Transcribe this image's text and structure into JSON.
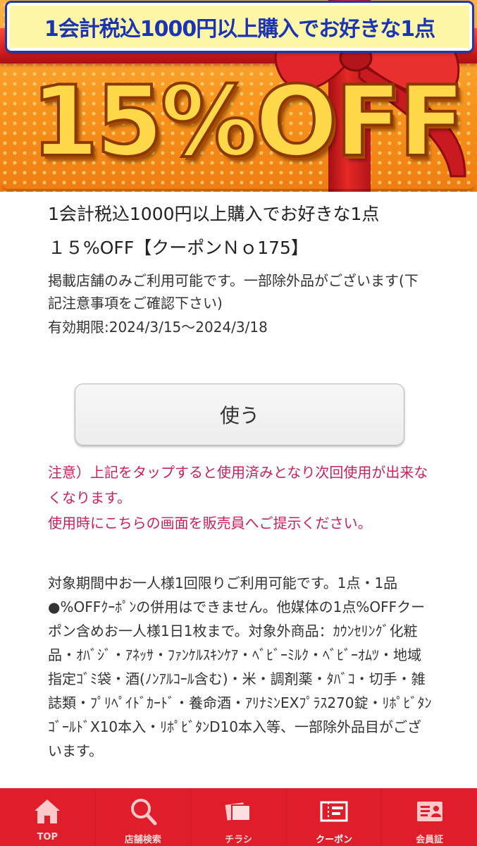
{
  "banner": {
    "headline": "1会計税込1000円以上購入でお好きな1点",
    "discount": "15%OFF",
    "colors": {
      "background": "#f7941d",
      "ribbon": "#d61f1f",
      "headline_text": "#1a34b5",
      "discount_text": "#ffd84a"
    }
  },
  "coupon": {
    "title_line1": "1会計税込1000円以上購入でお好きな1点",
    "title_line2": "１５%OFF【クーポンＮｏ175】",
    "description": "掲載店舗のみご利用可能です。一部除外品がございます(下記注意事項をご確認下さい)",
    "validity": "有効期限:2024/3/15～2024/3/18",
    "use_button": "使う",
    "warning_line1": "注意）上記をタップすると使用済みとなり次回使用が出来なくなります。",
    "warning_line2": "使用時にこちらの画面を販売員へご提示ください。",
    "terms": "対象期間中お一人様1回限りご利用可能です。1点・1品●%OFFｸｰﾎﾟﾝの併用はできません。他媒体の1点%OFFクーポン含めお一人様1日1枚まで。対象外商品：ｶｳﾝｾﾘﾝｸﾞ化粧品・ｵﾊﾞｼﾞ・ｱﾈｯｻ・ﾌｧﾝｹﾙｽｷﾝｹｱ・ﾍﾞﾋﾞｰﾐﾙｸ・ﾍﾞﾋﾞｰｵﾑﾂ・地域指定ｺﾞﾐ袋・酒(ﾉﾝｱﾙｺｰﾙ含む)・米・調剤薬・ﾀﾊﾞｺ・切手・雑誌類・ﾌﾟﾘﾍﾟｲﾄﾞｶｰﾄﾞ・養命酒・ｱﾘﾅﾐﾝEXﾌﾟﾗｽ270錠・ﾘﾎﾟﾋﾞﾀﾝｺﾞｰﾙﾄﾞX10本入・ﾘﾎﾟﾋﾞﾀﾝD10本入等、一部除外品目がございます。",
    "colors": {
      "warning": "#cc1f5c",
      "text": "#333333"
    }
  },
  "nav": {
    "background": "#e01e2b",
    "tabs": [
      {
        "label": "TOP",
        "icon": "home-icon"
      },
      {
        "label": "店舗検索",
        "icon": "search-icon"
      },
      {
        "label": "チラシ",
        "icon": "flyer-icon"
      },
      {
        "label": "クーポン",
        "icon": "coupon-icon",
        "active": true
      },
      {
        "label": "会員証",
        "icon": "member-card-icon"
      }
    ]
  }
}
